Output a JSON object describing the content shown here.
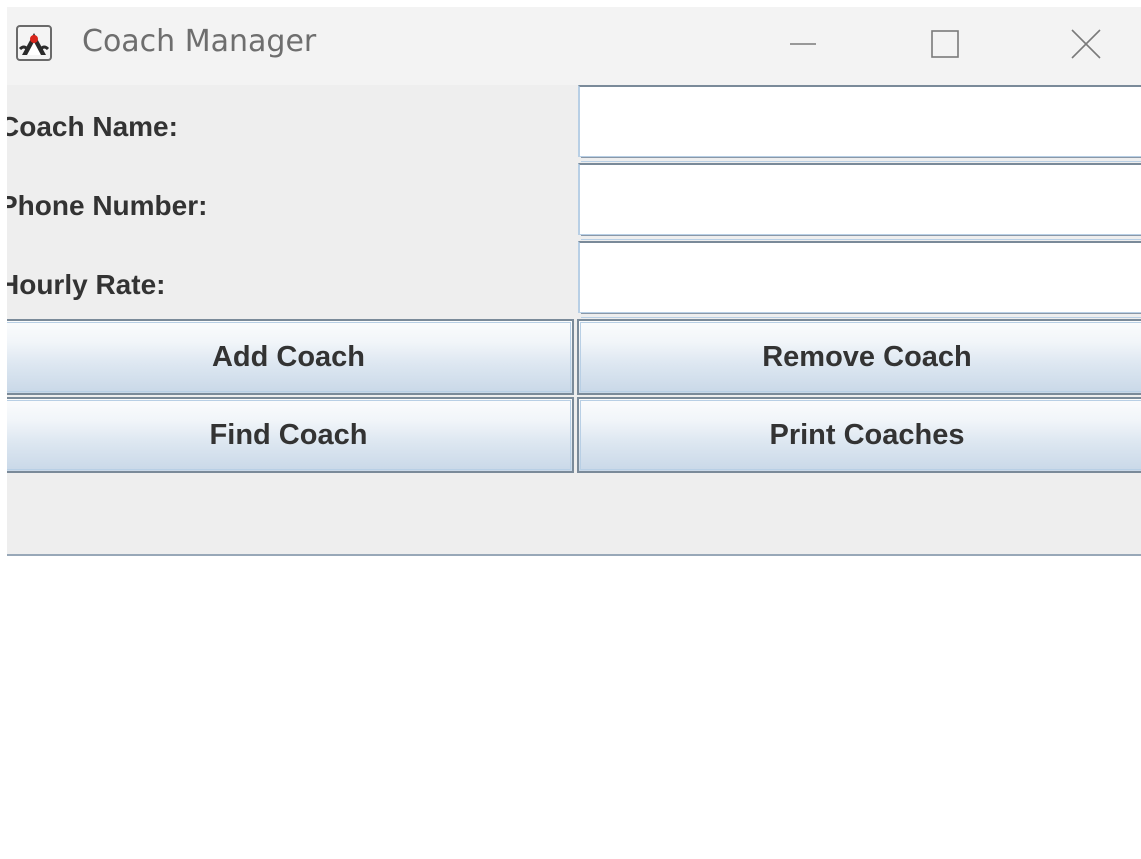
{
  "window": {
    "title": "Coach Manager",
    "icon": "java-duke-icon"
  },
  "form": {
    "fields": [
      {
        "label": "Coach Name:",
        "value": "",
        "placeholder": ""
      },
      {
        "label": "Phone Number:",
        "value": "",
        "placeholder": ""
      },
      {
        "label": "Hourly Rate:",
        "value": "",
        "placeholder": ""
      }
    ]
  },
  "buttons": {
    "add": "Add Coach",
    "remove": "Remove Coach",
    "find": "Find Coach",
    "print": "Print Coaches"
  },
  "status": {
    "text": ""
  },
  "colors": {
    "window_bg": "#eeeeee",
    "titlebar_bg": "#f3f3f3",
    "button_top": "#fbfcfd",
    "button_bottom": "#c9d8e8",
    "border": "#7a8a99"
  }
}
